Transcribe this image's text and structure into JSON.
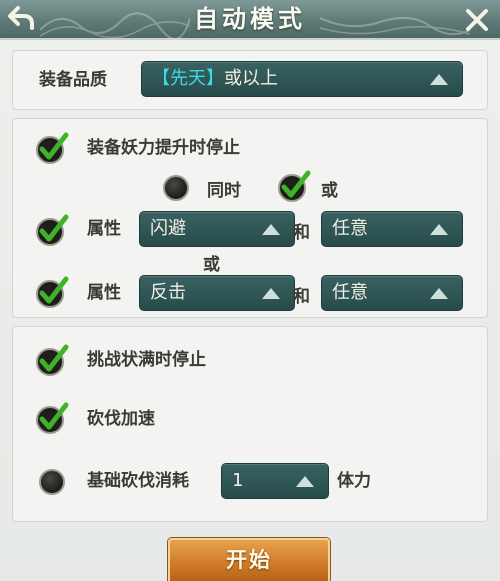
{
  "header": {
    "title": "自动模式"
  },
  "quality": {
    "label": "装备品质",
    "value_highlight": "【先天】",
    "value_rest": "或以上"
  },
  "stop_demon": {
    "label": "装备妖力提升时停止",
    "checked": true
  },
  "logic": {
    "same_time_label": "同时",
    "same_time_selected": false,
    "or_label": "或",
    "or_selected": true
  },
  "attr_row_1": {
    "label": "属性",
    "first_value": "闪避",
    "and_label": "和",
    "second_value": "任意",
    "checked": true
  },
  "between_or": "或",
  "attr_row_2": {
    "label": "属性",
    "first_value": "反击",
    "and_label": "和",
    "second_value": "任意",
    "checked": true
  },
  "stop_full": {
    "label": "挑战状满时停止",
    "checked": true
  },
  "chop_speed": {
    "label": "砍伐加速",
    "checked": true
  },
  "chop_cost": {
    "label": "基础砍伐消耗",
    "value": "1",
    "unit": "体力",
    "selected": false
  },
  "start_button": {
    "label": "开始"
  },
  "colors": {
    "header": "#5f7b78",
    "dropdown": "#2f5656",
    "highlight": "#3dd9e6",
    "check_green": "#3fb328",
    "start_button": "#d27c2a"
  },
  "icons": [
    "back-arrow-icon",
    "close-icon",
    "checkmark-icon",
    "chevron-up-icon"
  ]
}
